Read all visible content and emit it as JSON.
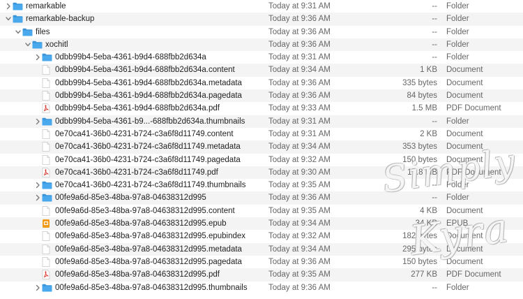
{
  "rows": [
    {
      "indent": 0,
      "chevron": "right",
      "icon": "folder",
      "name": "remarkable",
      "date": "Today at 9:31 AM",
      "size": "--",
      "kind": "Folder"
    },
    {
      "indent": 0,
      "chevron": "down",
      "icon": "folder",
      "name": "remarkable-backup",
      "date": "Today at 9:36 AM",
      "size": "--",
      "kind": "Folder"
    },
    {
      "indent": 1,
      "chevron": "down",
      "icon": "folder",
      "name": "files",
      "date": "Today at 9:36 AM",
      "size": "--",
      "kind": "Folder"
    },
    {
      "indent": 2,
      "chevron": "down",
      "icon": "folder",
      "name": "xochitl",
      "date": "Today at 9:36 AM",
      "size": "--",
      "kind": "Folder"
    },
    {
      "indent": 3,
      "chevron": "right",
      "icon": "folder",
      "name": "0dbb99b4-5eba-4361-b9d4-688fbb2d634a",
      "date": "Today at 9:31 AM",
      "size": "--",
      "kind": "Folder"
    },
    {
      "indent": 3,
      "chevron": "",
      "icon": "doc",
      "name": "0dbb99b4-5eba-4361-b9d4-688fbb2d634a.content",
      "date": "Today at 9:34 AM",
      "size": "1 KB",
      "kind": "Document"
    },
    {
      "indent": 3,
      "chevron": "",
      "icon": "doc",
      "name": "0dbb99b4-5eba-4361-b9d4-688fbb2d634a.metadata",
      "date": "Today at 9:36 AM",
      "size": "335 bytes",
      "kind": "Document"
    },
    {
      "indent": 3,
      "chevron": "",
      "icon": "doc",
      "name": "0dbb99b4-5eba-4361-b9d4-688fbb2d634a.pagedata",
      "date": "Today at 9:36 AM",
      "size": "84 bytes",
      "kind": "Document"
    },
    {
      "indent": 3,
      "chevron": "",
      "icon": "pdf",
      "name": "0dbb99b4-5eba-4361-b9d4-688fbb2d634a.pdf",
      "date": "Today at 9:33 AM",
      "size": "1.5 MB",
      "kind": "PDF Document"
    },
    {
      "indent": 3,
      "chevron": "right",
      "icon": "folder",
      "name": "0dbb99b4-5eba-4361-b9...-688fbb2d634a.thumbnails",
      "date": "Today at 9:31 AM",
      "size": "--",
      "kind": "Folder"
    },
    {
      "indent": 3,
      "chevron": "",
      "icon": "doc",
      "name": "0e70ca41-36b0-4231-b724-c3a6f8d11749.content",
      "date": "Today at 9:31 AM",
      "size": "2 KB",
      "kind": "Document"
    },
    {
      "indent": 3,
      "chevron": "",
      "icon": "doc",
      "name": "0e70ca41-36b0-4231-b724-c3a6f8d11749.metadata",
      "date": "Today at 9:34 AM",
      "size": "353 bytes",
      "kind": "Document"
    },
    {
      "indent": 3,
      "chevron": "",
      "icon": "doc",
      "name": "0e70ca41-36b0-4231-b724-c3a6f8d11749.pagedata",
      "date": "Today at 9:32 AM",
      "size": "150 bytes",
      "kind": "Document"
    },
    {
      "indent": 3,
      "chevron": "",
      "icon": "pdf",
      "name": "0e70ca41-36b0-4231-b724-c3a6f8d11749.pdf",
      "date": "Today at 9:30 AM",
      "size": "17.8 MB",
      "kind": "PDF Document"
    },
    {
      "indent": 3,
      "chevron": "right",
      "icon": "folder",
      "name": "0e70ca41-36b0-4231-b724-c3a6f8d11749.thumbnails",
      "date": "Today at 9:35 AM",
      "size": "--",
      "kind": "Folder"
    },
    {
      "indent": 3,
      "chevron": "right",
      "icon": "folder",
      "name": "00fe9a6d-85e3-48ba-97a8-04638312d995",
      "date": "Today at 9:36 AM",
      "size": "--",
      "kind": "Folder"
    },
    {
      "indent": 3,
      "chevron": "",
      "icon": "doc",
      "name": "00fe9a6d-85e3-48ba-97a8-04638312d995.content",
      "date": "Today at 9:35 AM",
      "size": "4 KB",
      "kind": "Document"
    },
    {
      "indent": 3,
      "chevron": "",
      "icon": "epub",
      "name": "00fe9a6d-85e3-48ba-97a8-04638312d995.epub",
      "date": "Today at 9:34 AM",
      "size": "34 KB",
      "kind": "EPUB"
    },
    {
      "indent": 3,
      "chevron": "",
      "icon": "doc",
      "name": "00fe9a6d-85e3-48ba-97a8-04638312d995.epubindex",
      "date": "Today at 9:32 AM",
      "size": "182 bytes",
      "kind": "Document"
    },
    {
      "indent": 3,
      "chevron": "",
      "icon": "doc",
      "name": "00fe9a6d-85e3-48ba-97a8-04638312d995.metadata",
      "date": "Today at 9:34 AM",
      "size": "295 bytes",
      "kind": "Document"
    },
    {
      "indent": 3,
      "chevron": "",
      "icon": "doc",
      "name": "00fe9a6d-85e3-48ba-97a8-04638312d995.pagedata",
      "date": "Today at 9:36 AM",
      "size": "150 bytes",
      "kind": "Document"
    },
    {
      "indent": 3,
      "chevron": "",
      "icon": "pdf",
      "name": "00fe9a6d-85e3-48ba-97a8-04638312d995.pdf",
      "date": "Today at 9:35 AM",
      "size": "277 KB",
      "kind": "PDF Document"
    },
    {
      "indent": 3,
      "chevron": "right",
      "icon": "folder",
      "name": "00fe9a6d-85e3-48ba-97a8-04638312d995.thumbnails",
      "date": "Today at 9:36 AM",
      "size": "--",
      "kind": "Folder"
    }
  ],
  "watermark": {
    "line1": "Simply",
    "line2": "Kyra"
  },
  "colors": {
    "folder": "#4aa8ec",
    "folder_tab": "#3b95d9",
    "pdf": "#d9352b",
    "epub": "#f29a1a",
    "alt_row": "#f4f4f5"
  }
}
